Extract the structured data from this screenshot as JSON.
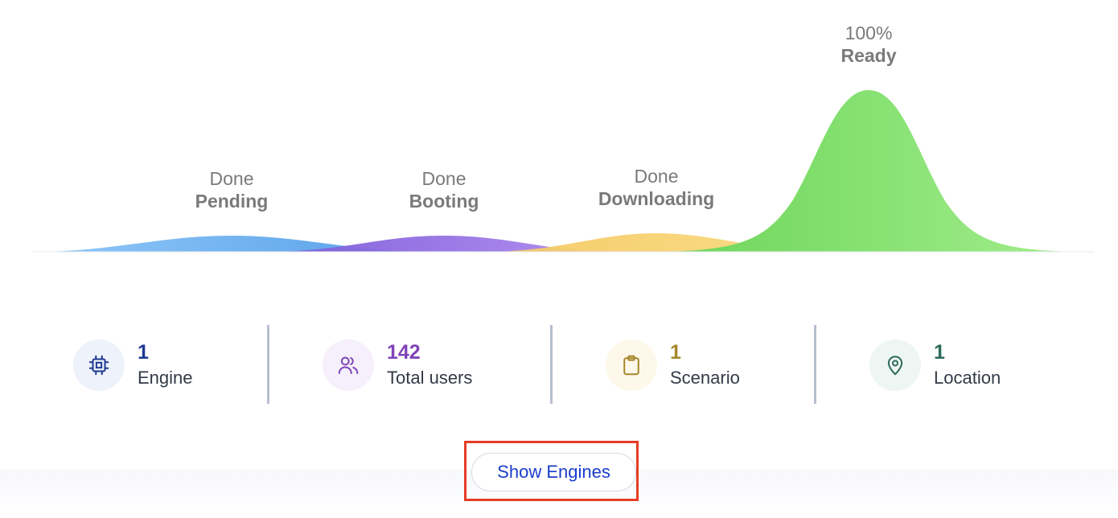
{
  "phases": [
    {
      "status": "Done",
      "phase": "Pending",
      "color": "#5aa8f0"
    },
    {
      "status": "Done",
      "phase": "Booting",
      "color": "#9b6fe6"
    },
    {
      "status": "Done",
      "phase": "Downloading",
      "color": "#f7d46a"
    },
    {
      "status": "100%",
      "phase": "Ready",
      "color": "#7fe06a"
    }
  ],
  "stats": [
    {
      "value": "1",
      "label": "Engine",
      "icon": "cpu-icon",
      "color": "#1f3a93"
    },
    {
      "value": "142",
      "label": "Total users",
      "icon": "users-icon",
      "color": "#8044b8"
    },
    {
      "value": "1",
      "label": "Scenario",
      "icon": "clipboard-icon",
      "color": "#a5872a"
    },
    {
      "value": "1",
      "label": "Location",
      "icon": "location-pin-icon",
      "color": "#2d6b5a"
    }
  ],
  "show_engines_label": "Show Engines"
}
